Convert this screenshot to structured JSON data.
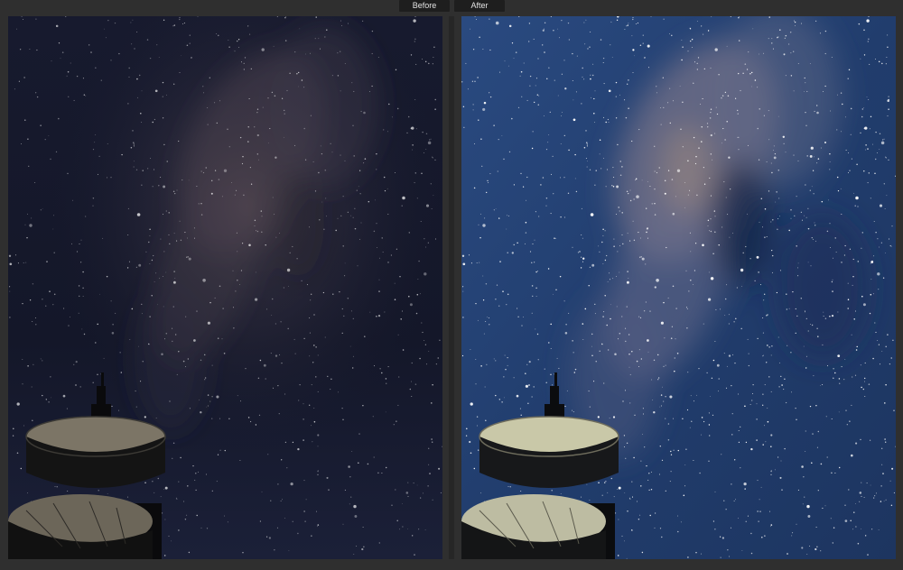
{
  "labels": {
    "before": "Before",
    "after": "After"
  },
  "colors": {
    "window_bg": "#2f2f2f",
    "label_bg": "#1e1e1e",
    "label_text": "#e2e2e2",
    "before_sky": "#13162a",
    "after_sky": "#24406e"
  }
}
